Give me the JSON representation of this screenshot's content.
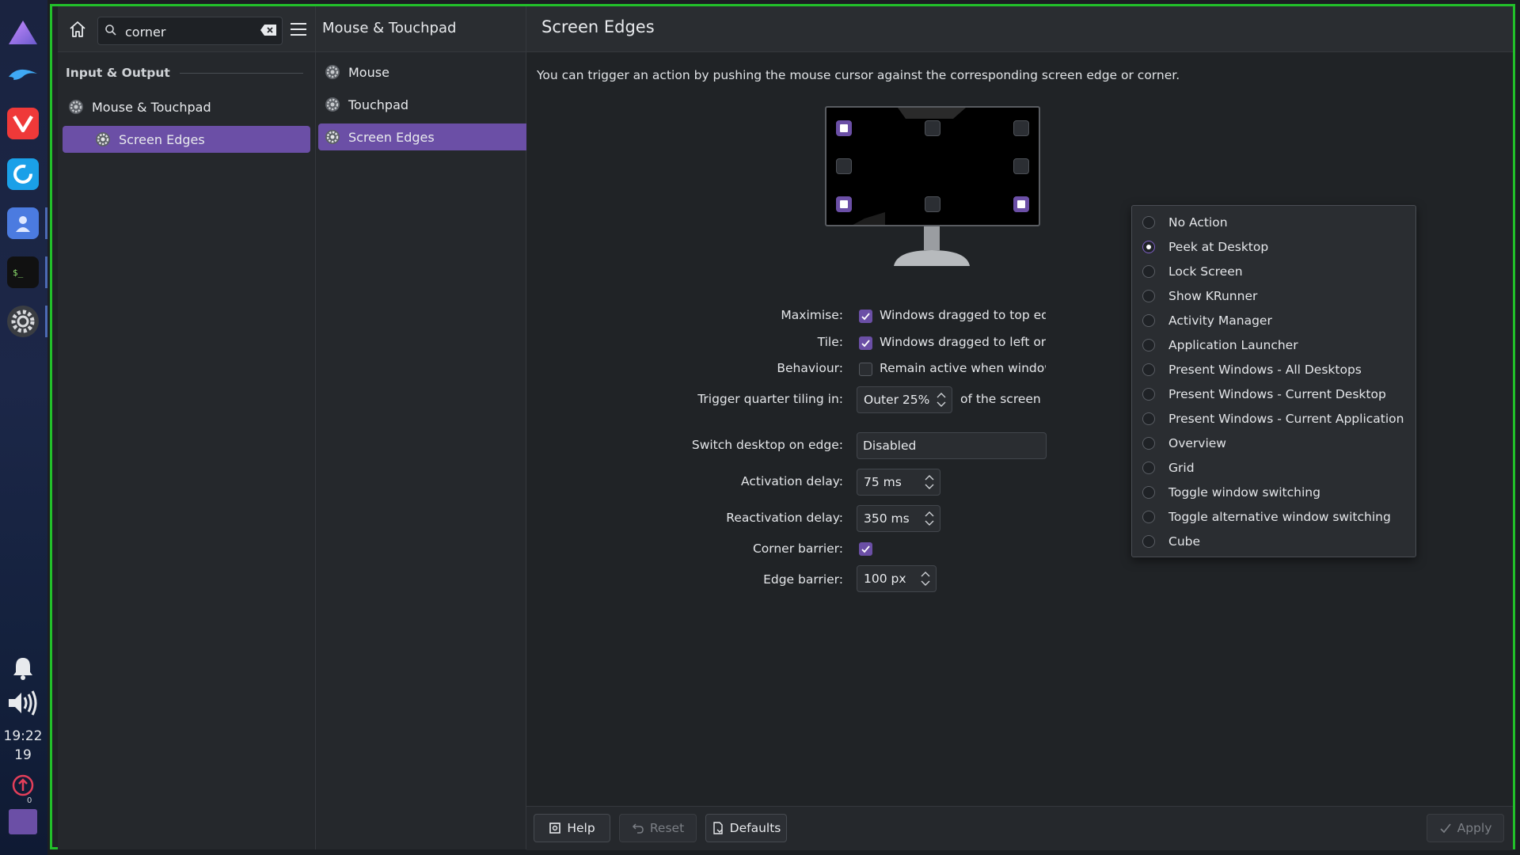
{
  "taskbar": {
    "apps": [
      {
        "name": "launcher-icon"
      },
      {
        "name": "dolphin-icon"
      },
      {
        "name": "vivaldi-icon"
      },
      {
        "name": "sync-icon"
      },
      {
        "name": "contacts-icon"
      },
      {
        "name": "terminal-icon"
      },
      {
        "name": "settings-icon"
      }
    ],
    "clock": {
      "time": "19:22",
      "date": "19"
    },
    "update_badge": "0"
  },
  "sidebar": {
    "search_value": "corner",
    "group_title": "Input & Output",
    "items": [
      {
        "label": "Mouse & Touchpad"
      },
      {
        "label": "Screen Edges"
      }
    ]
  },
  "subpanel": {
    "title": "Mouse & Touchpad",
    "items": [
      {
        "label": "Mouse"
      },
      {
        "label": "Touchpad"
      },
      {
        "label": "Screen Edges"
      }
    ]
  },
  "main": {
    "title": "Screen Edges",
    "description": "You can trigger an action by pushing the mouse cursor against the corresponding screen edge or corner.",
    "form": {
      "maximise_label": "Maximise:",
      "maximise_text": "Windows dragged to top edge",
      "tile_label": "Tile:",
      "tile_text": "Windows dragged to left or right edge",
      "behaviour_label": "Behaviour:",
      "behaviour_text": "Remain active when windows are fullscreen",
      "quarter_label": "Trigger quarter tiling in:",
      "quarter_value": "Outer 25%",
      "quarter_suffix": "of the screen",
      "switch_label": "Switch desktop on edge:",
      "switch_value": "Disabled",
      "activation_label": "Activation delay:",
      "activation_value": "75 ms",
      "reactivation_label": "Reactivation delay:",
      "reactivation_value": "350 ms",
      "corner_label": "Corner barrier:",
      "edge_label": "Edge barrier:",
      "edge_value": "100 px"
    },
    "footer": {
      "help": "Help",
      "reset": "Reset",
      "defaults": "Defaults",
      "apply": "Apply"
    }
  },
  "popup": {
    "options": [
      {
        "label": "No Action"
      },
      {
        "label": "Peek at Desktop"
      },
      {
        "label": "Lock Screen"
      },
      {
        "label": "Show KRunner"
      },
      {
        "label": "Activity Manager"
      },
      {
        "label": "Application Launcher"
      },
      {
        "label": "Present Windows - All Desktops"
      },
      {
        "label": "Present Windows - Current Desktop"
      },
      {
        "label": "Present Windows - Current Application"
      },
      {
        "label": "Overview"
      },
      {
        "label": "Grid"
      },
      {
        "label": "Toggle window switching"
      },
      {
        "label": "Toggle alternative window switching"
      },
      {
        "label": "Cube"
      }
    ],
    "selected": "Peek at Desktop"
  },
  "colors": {
    "accent": "#6b4fa6",
    "window_border": "#22c02a"
  }
}
